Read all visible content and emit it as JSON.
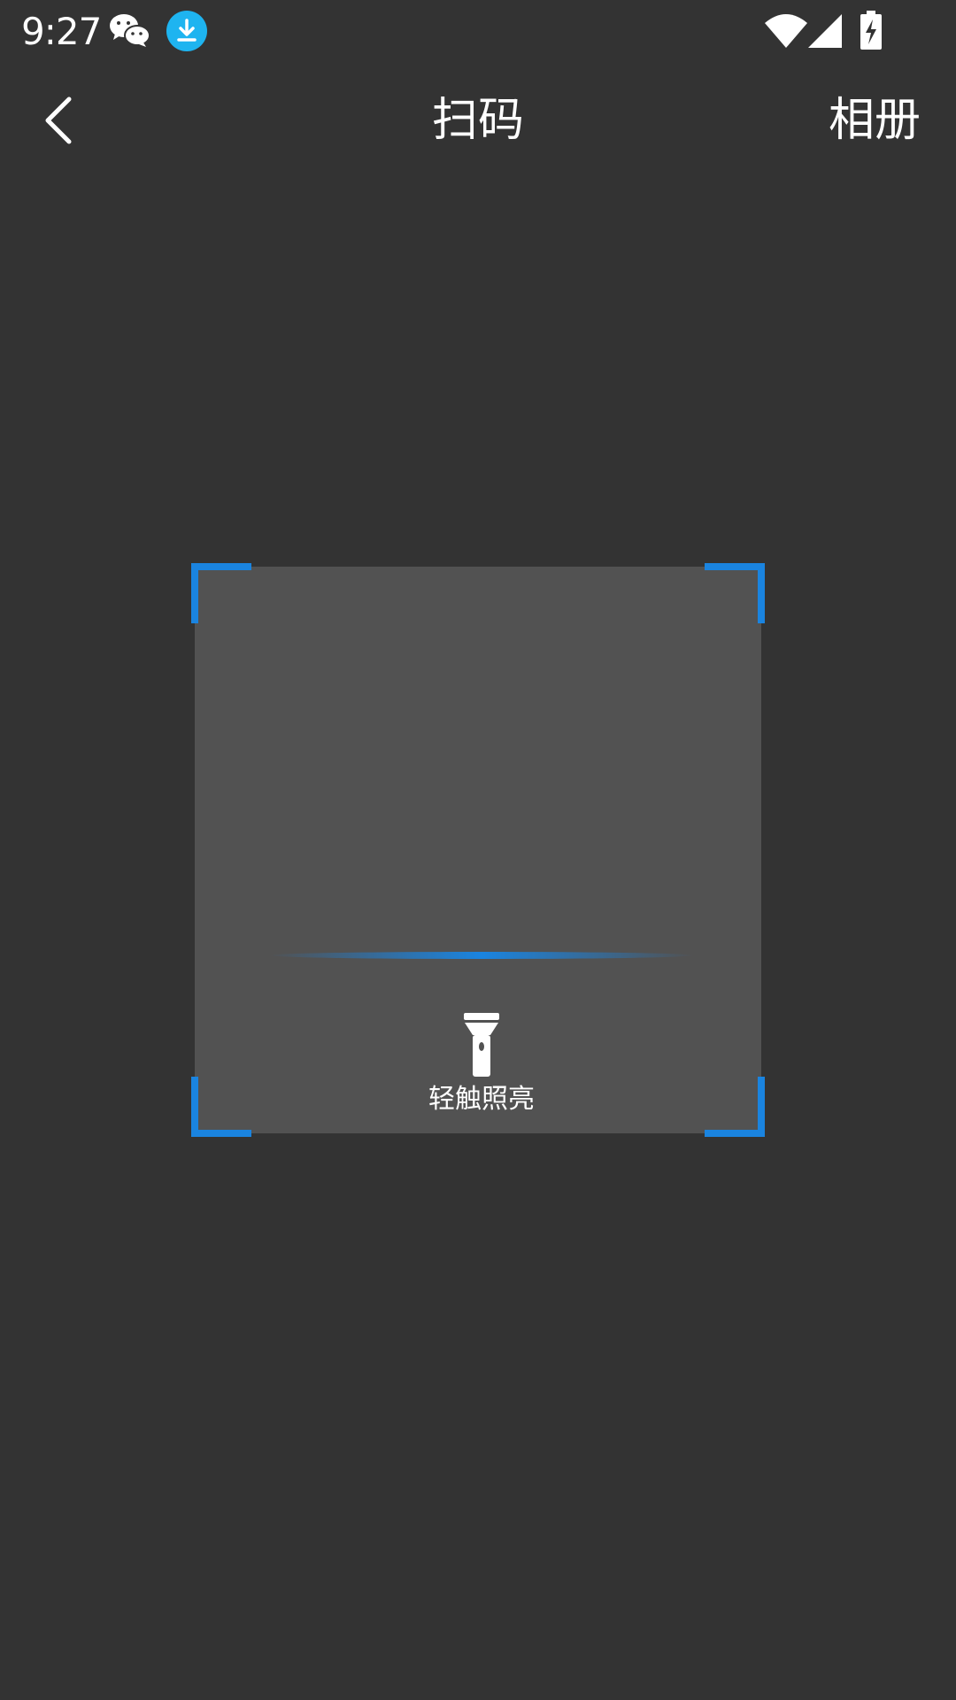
{
  "status_bar": {
    "time": "9:27",
    "icons": [
      "wechat-icon",
      "download-icon",
      "wifi-icon",
      "signal-icon",
      "battery-charging-icon"
    ]
  },
  "toolbar": {
    "title": "扫码",
    "album_label": "相册",
    "back_icon": "chevron-left-icon"
  },
  "scanner": {
    "torch_label": "轻触照亮",
    "torch_icon": "flashlight-icon"
  },
  "colors": {
    "background": "#333333",
    "scan_box": "#525252",
    "accent": "#1a84e0",
    "download_badge": "#1eb4f0",
    "text": "#ffffff"
  }
}
